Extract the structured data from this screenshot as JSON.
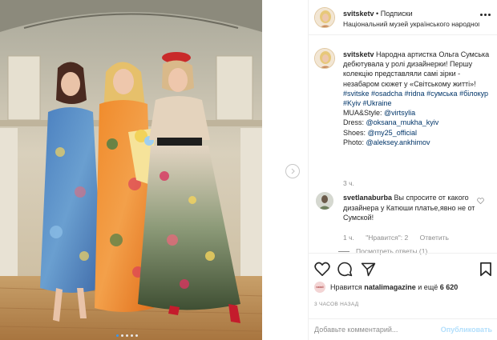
{
  "header": {
    "username": "svitsketv",
    "dot": "•",
    "follow_label": "Подписки",
    "location": "Національний музей українського народног..."
  },
  "caption": {
    "username": "svitsketv",
    "text": "Народна артистка Ольга Сумська дебютувала у ролі дизайнерки! Першу колекцію представляли самі зірки - незабаром сюжет у «Світському житті»!",
    "hashtags": [
      "#svitske",
      "#osadcha",
      "#ridna",
      "#сумська",
      "#білокур",
      "#Kyiv",
      "#Ukraine"
    ],
    "credits": [
      {
        "label": "MUA&Style:",
        "tag": "@virtsylia"
      },
      {
        "label": "Dress:",
        "tag": "@oksana_mukha_kyiv"
      },
      {
        "label": "Shoes:",
        "tag": "@my25_official"
      },
      {
        "label": "Photo:",
        "tag": "@aleksey.ankhimov"
      }
    ],
    "time": "3 ч."
  },
  "comment": {
    "username": "svetlanaburba",
    "text": "Вы спросите от какого дизайнера у Катюши платье,явно не от Сумской!",
    "time": "1 ч.",
    "likes": "\"Нравится\": 2",
    "reply_label": "Ответить",
    "view_replies": "Посмотреть ответы (1)"
  },
  "likes": {
    "prefix": "Нравится",
    "user": "natalimagazine",
    "suffix": "и ещё",
    "count": "6 620",
    "mini_avatar_text": "natali"
  },
  "posted_ago": "3 ЧАСОВ НАЗАД",
  "add_comment": {
    "placeholder": "Добавьте комментарий...",
    "post_label": "Опубликовать"
  },
  "icons": {
    "more": "more-dots-icon",
    "comment_heart": "heart-outline-icon",
    "like": "heart-icon",
    "comment": "comment-icon",
    "share": "share-icon",
    "save": "bookmark-icon",
    "next": "chevron-right-icon"
  },
  "carousel": {
    "slides": 5,
    "active": 1
  }
}
